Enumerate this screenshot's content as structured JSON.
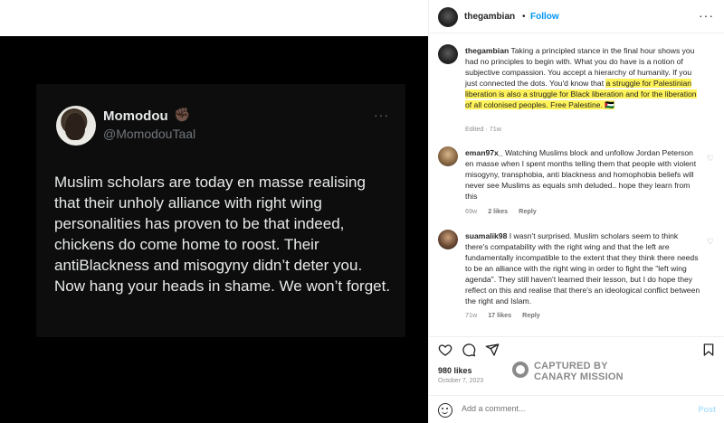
{
  "tweet": {
    "name": "Momodou",
    "name_emoji": "✊🏿",
    "handle": "@MomodouTaal",
    "more": "···",
    "text": "Muslim scholars are today en masse realising that their unholy alliance with right wing personalities has proven to be that indeed, chickens do come home to roost. Their antiBlackness and misogyny didn’t deter you. Now hang your heads in shame. We won’t forget."
  },
  "header": {
    "username": "thegambian",
    "dot": "•",
    "follow_label": "Follow",
    "more": "···"
  },
  "caption": {
    "username": "thegambian",
    "text_before": " Taking a principled stance in the final hour shows you had no principles to begin with. What you do have is a notion of subjective compassion. You accept a hierarchy of humanity. If you just connected the dots. You'd know that ",
    "text_highlight": "a struggle for Palestinian liberation is also a struggle for Black liberation and for the liberation of all colonised peoples. Free Palestine. 🇵🇸",
    "meta": "Edited · 71w"
  },
  "comments": [
    {
      "username": "eman97x_",
      "text": " Watching Muslims block and unfollow Jordan Peterson en masse when I spent months telling them that people with violent misogyny, transphobia, anti blackness and homophobia beliefs will never see Muslims as equals smh deluded.. hope they learn from this",
      "time": "69w",
      "likes": "2 likes",
      "reply": "Reply"
    },
    {
      "username": "suamalik98",
      "text": " I wasn't surprised. Muslim scholars seem to think there's compatability with the right wing and that the left are fundamentally incompatible to the extent that they think there needs to be an alliance with the right wing in order to fight the \"left wing agenda\". They still haven't learned their lesson, but I do hope they reflect on this and realise that there's an ideological conflict between the right and Islam.",
      "time": "71w",
      "likes": "17 likes",
      "reply": "Reply"
    }
  ],
  "post": {
    "likes": "980 likes",
    "date": "October 7, 2023"
  },
  "watermark": {
    "line1": "CAPTURED BY",
    "line2": "CANARY MISSION"
  },
  "add_comment": {
    "placeholder": "Add a comment...",
    "post_label": "Post"
  }
}
